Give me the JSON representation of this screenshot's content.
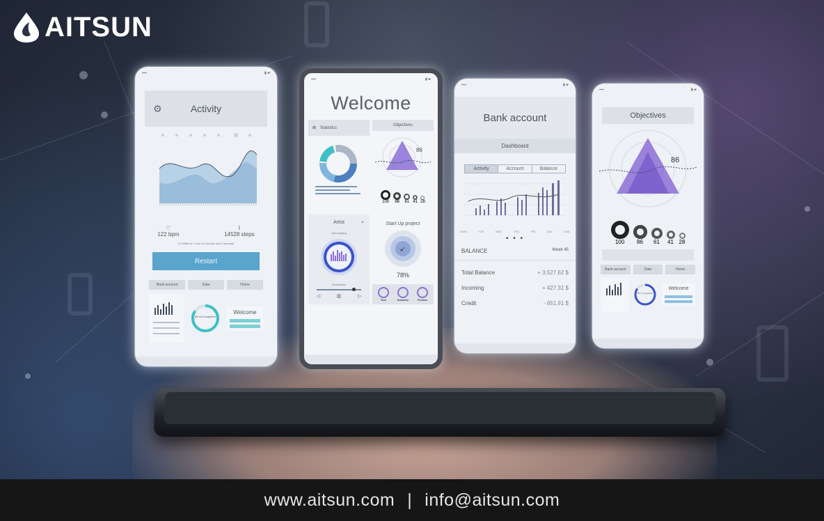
{
  "brand": {
    "name": "AITSUN"
  },
  "footer": {
    "website": "www.aitsun.com",
    "separator": "|",
    "email": "info@aitsun.com"
  },
  "colors": {
    "accent_blue": "#5aa5cc",
    "accent_purple": "#8c6fd6",
    "footer_bg": "#161616"
  },
  "phone_activity": {
    "title": "Activity",
    "heart_rate": "122 bpm",
    "steps": "14528 steps",
    "note": "2.4 Miles in 1 hour 51 minutes and 2 seconds",
    "restart_label": "Restart",
    "tabs": [
      "Bank account",
      "Data",
      "Home"
    ],
    "mini_welcome": "Welcome",
    "mini_percent": "85 % Completed"
  },
  "phone_welcome": {
    "title": "Welcome",
    "statistics_label": "Statistics",
    "objectives_label": "Objectives",
    "objectives_value": "86",
    "rings": [
      "100",
      "86",
      "61",
      "41",
      "28"
    ],
    "artist_label": "Artist",
    "now_playing": "Now playing",
    "soundtrack": "Soundtrack",
    "startup_label": "Start Up project",
    "startup_percent": "78%",
    "categories": [
      "Tech",
      "Business",
      "Finance"
    ]
  },
  "phone_bank": {
    "title": "Bank account",
    "dashboard": "Dashboard",
    "tabs": [
      "Activity",
      "Account",
      "Balance"
    ],
    "months": [
      "MON",
      "TUE",
      "WED",
      "THU",
      "FRI",
      "SAT",
      "SUN"
    ],
    "dots": "• • •",
    "balance_label": "BALANCE",
    "week": "Week 45",
    "rows": [
      {
        "label": "Total Balance",
        "value": "+ 3,527.62 $"
      },
      {
        "label": "Incoming",
        "value": "+ 427.31 $"
      },
      {
        "label": "Credit",
        "value": "- 651.91 $"
      }
    ]
  },
  "phone_objectives": {
    "title": "Objectives",
    "value": "86",
    "rings": [
      "100",
      "86",
      "61",
      "41",
      "28"
    ],
    "tabs": [
      "Bank account",
      "Data",
      "Home"
    ],
    "mini_welcome": "Welcome",
    "mini_percent": "85 % Completed"
  }
}
